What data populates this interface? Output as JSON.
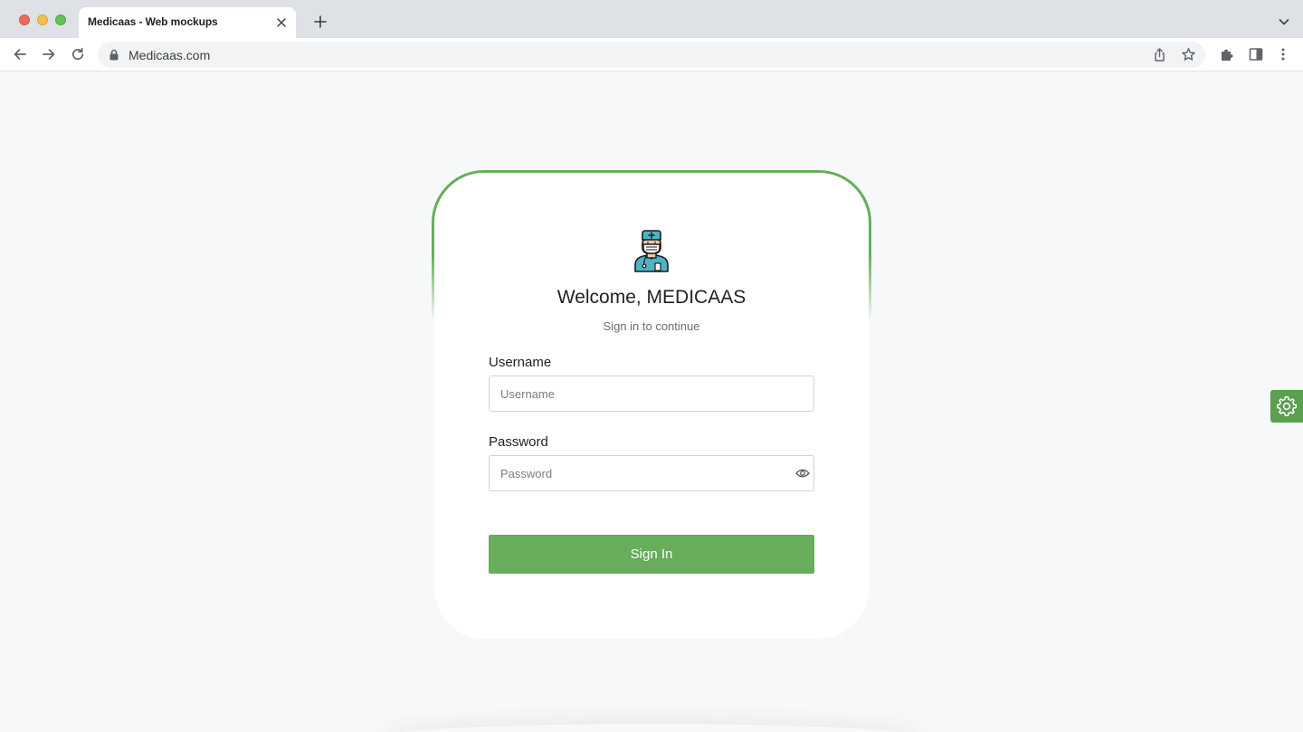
{
  "browser": {
    "tab_title": "Medicaas - Web mockups",
    "url": "Medicaas.com"
  },
  "login": {
    "welcome": "Welcome, MEDICAAS",
    "subtitle": "Sign in to continue",
    "username_label": "Username",
    "username_placeholder": "Username",
    "username_value": "",
    "password_label": "Password",
    "password_placeholder": "Password",
    "password_value": "",
    "submit_label": "Sign In"
  },
  "icons": {
    "avatar": "doctor-avatar-icon",
    "password_toggle": "eye-icon",
    "settings": "gear-icon"
  },
  "colors": {
    "accent": "#67ad5b",
    "page_background": "#f7f8fa",
    "card_background": "#ffffff"
  }
}
